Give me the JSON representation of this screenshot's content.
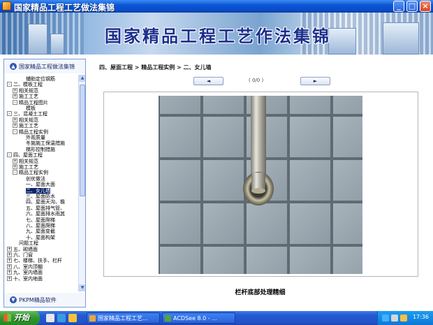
{
  "window": {
    "title": "国家精品工程工艺做法集锦",
    "controls": {
      "minimize": "_",
      "maximize": "□",
      "close": "×"
    }
  },
  "banner": {
    "text": "国家精品工程工艺作法集锦"
  },
  "tree": {
    "header": "国家精品工程做法集锦",
    "footer": "PKPM精品软件",
    "nodes": [
      {
        "text": "辅助定位钢筋",
        "level": 2,
        "expander": ""
      },
      {
        "text": "二、模板工程",
        "level": 0,
        "expander": "-"
      },
      {
        "text": "相关规范",
        "level": 1,
        "expander": "+"
      },
      {
        "text": "施工工艺",
        "level": 1,
        "expander": "+"
      },
      {
        "text": "精品工程图片",
        "level": 1,
        "expander": "-"
      },
      {
        "text": "模板",
        "level": 2,
        "expander": ""
      },
      {
        "text": "三、混凝土工程",
        "level": 0,
        "expander": "-"
      },
      {
        "text": "相关规范",
        "level": 1,
        "expander": "+"
      },
      {
        "text": "施工工艺",
        "level": 1,
        "expander": "+"
      },
      {
        "text": "精品工程实例",
        "level": 1,
        "expander": "-"
      },
      {
        "text": "外观质量",
        "level": 2,
        "expander": ""
      },
      {
        "text": "冬施施工保温措施",
        "level": 2,
        "expander": ""
      },
      {
        "text": "梯形控制措施",
        "level": 2,
        "expander": ""
      },
      {
        "text": "四、屋面工程",
        "level": 0,
        "expander": "-"
      },
      {
        "text": "相关规范",
        "level": 1,
        "expander": "+"
      },
      {
        "text": "施工工艺",
        "level": 1,
        "expander": "+"
      },
      {
        "text": "精品工程实例",
        "level": 1,
        "expander": "-"
      },
      {
        "text": "创优做法",
        "level": 2,
        "expander": ""
      },
      {
        "text": "一、屋面大面",
        "level": 2,
        "expander": ""
      },
      {
        "text": "二、女儿墙",
        "level": 2,
        "expander": "",
        "selected": true
      },
      {
        "text": "三、屋面防水",
        "level": 2,
        "expander": ""
      },
      {
        "text": "四、屋面天沟、檐",
        "level": 2,
        "expander": ""
      },
      {
        "text": "五、屋面排气管、",
        "level": 2,
        "expander": ""
      },
      {
        "text": "六、屋面排水雨其",
        "level": 2,
        "expander": ""
      },
      {
        "text": "七、屋面爬梯",
        "level": 2,
        "expander": ""
      },
      {
        "text": "八、屋面爬梯",
        "level": 2,
        "expander": ""
      },
      {
        "text": "九、屋面变截",
        "level": 2,
        "expander": ""
      },
      {
        "text": "十、屋面构架",
        "level": 2,
        "expander": ""
      },
      {
        "text": "问题工程",
        "level": 1,
        "expander": ""
      },
      {
        "text": "五、砌墙面",
        "level": 0,
        "expander": "+"
      },
      {
        "text": "六、门窗",
        "level": 0,
        "expander": "+"
      },
      {
        "text": "七、楼梯、扶手、栏杆",
        "level": 0,
        "expander": "+"
      },
      {
        "text": "八、室内顶棚",
        "level": 0,
        "expander": "+"
      },
      {
        "text": "九、室内墙面",
        "level": 0,
        "expander": "+"
      },
      {
        "text": "十、室内地面",
        "level": 0,
        "expander": "+"
      }
    ]
  },
  "content": {
    "breadcrumb": "四、屋面工程 > 精品工程实例 > 二、女儿墙",
    "prev_label": "◄",
    "next_label": "►",
    "pager": "( 0/0 )",
    "caption": "栏杆底部处理精细"
  },
  "taskbar": {
    "start_label": "开始",
    "tasks": [
      {
        "label": "国家精品工程工艺...",
        "active": false
      },
      {
        "label": "ACDSee 8.0 - ...",
        "active": false
      }
    ],
    "clock": "17:36"
  },
  "colors": {
    "titlebar": "#0a56d8",
    "selection": "#0a246a",
    "tree_border": "#7a9cd3"
  }
}
